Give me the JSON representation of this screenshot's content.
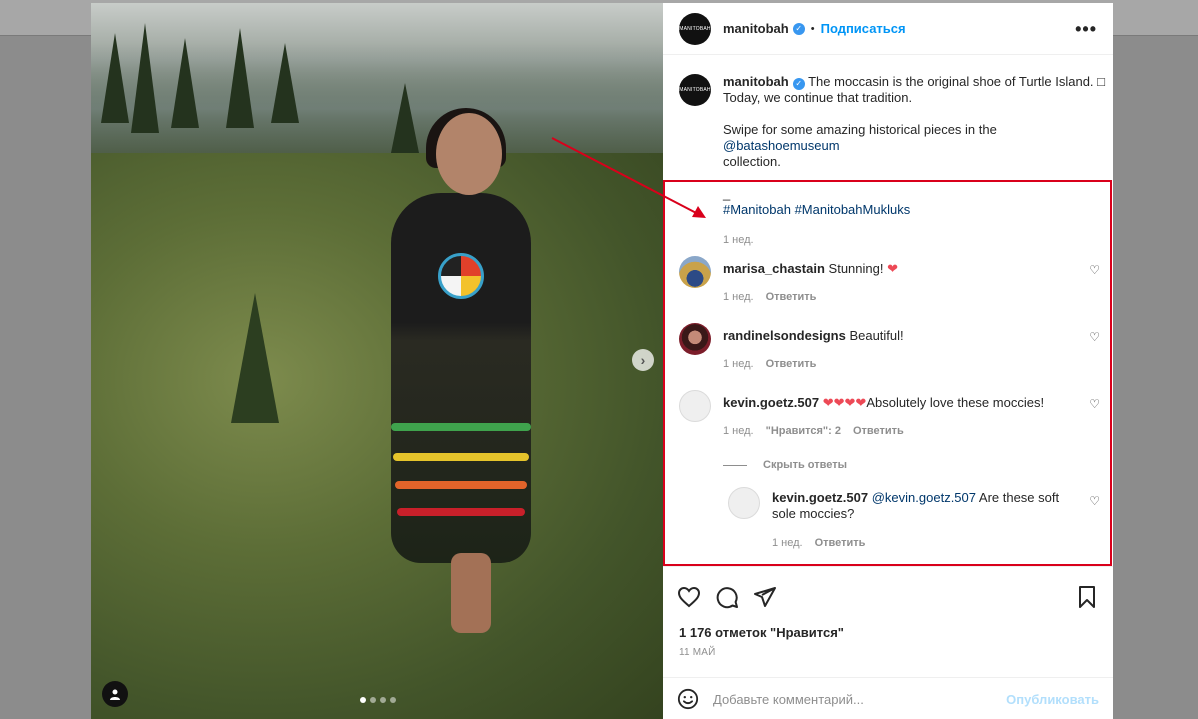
{
  "post": {
    "username": "manitobah",
    "logo_text": "MANITOBAH",
    "follow_label": "Подписаться",
    "more_label": "•••",
    "separator": "•"
  },
  "caption": {
    "username": "manitobah",
    "line1": " The moccasin is the original shoe of Turtle Island. ",
    "glyph": "□",
    "line2": "Today, we continue that tradition.",
    "line3_prefix": "Swipe for some amazing historical pieces in the ",
    "mention": "@batashoemuseum",
    "line3_suffix": "collection.",
    "underscore": "_",
    "hashtag1": "#Manitobah",
    "hashtag2": "#ManitobahMukluks",
    "time": "1 нед."
  },
  "comments": [
    {
      "username": "marisa_chastain",
      "text": "Stunning! ",
      "emoji": "❤",
      "time": "1 нед.",
      "reply": "Ответить"
    },
    {
      "username": "randinelsondesigns",
      "text": "Beautiful!",
      "time": "1 нед.",
      "reply": "Ответить"
    },
    {
      "username": "kevin.goetz.507",
      "emoji": "❤❤❤❤",
      "text": "Absolutely love these moccies!",
      "time": "1 нед.",
      "likes": "\"Нравится\": 2",
      "reply": "Ответить"
    }
  ],
  "hide_replies": "Скрыть ответы",
  "reply": {
    "username": "kevin.goetz.507",
    "mention": "@kevin.goetz.507",
    "text": " Are these soft sole moccies?",
    "time": "1 нед.",
    "reply": "Ответить"
  },
  "actions": {
    "likes": "1 176 отметок \"Нравится\"",
    "date": "11 МАЙ",
    "comment_placeholder": "Добавьте комментарий...",
    "publish": "Опубликовать"
  },
  "colors": {
    "accent": "#0095f6",
    "highlight_box": "#d9001b",
    "heart": "#ed4956"
  }
}
